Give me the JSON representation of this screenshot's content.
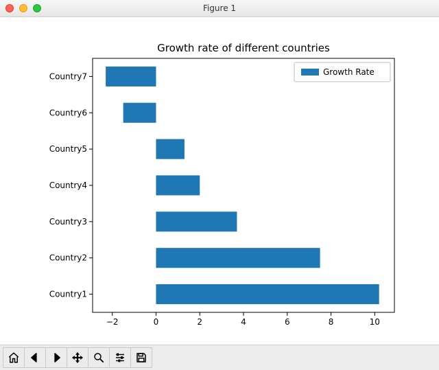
{
  "window": {
    "title": "Figure 1"
  },
  "chart_data": {
    "type": "bar",
    "orientation": "horizontal",
    "title": "Growth rate of different countries",
    "xlabel": "",
    "ylabel": "",
    "categories": [
      "Country1",
      "Country2",
      "Country3",
      "Country4",
      "Country5",
      "Country6",
      "Country7"
    ],
    "values": [
      10.2,
      7.5,
      3.7,
      2.0,
      1.3,
      -1.5,
      -2.3
    ],
    "series_name": "Growth Rate",
    "x_ticks": [
      -2,
      0,
      2,
      4,
      6,
      8,
      10
    ],
    "xlim": [
      -2.9,
      10.9
    ],
    "legend": {
      "position": "upper right",
      "entries": [
        "Growth Rate"
      ]
    },
    "bar_color": "#1f77b4"
  },
  "toolbar": {
    "home": "Home",
    "back": "Back",
    "forward": "Forward",
    "pan": "Pan",
    "zoom": "Zoom",
    "subplots": "Configure subplots",
    "save": "Save"
  }
}
